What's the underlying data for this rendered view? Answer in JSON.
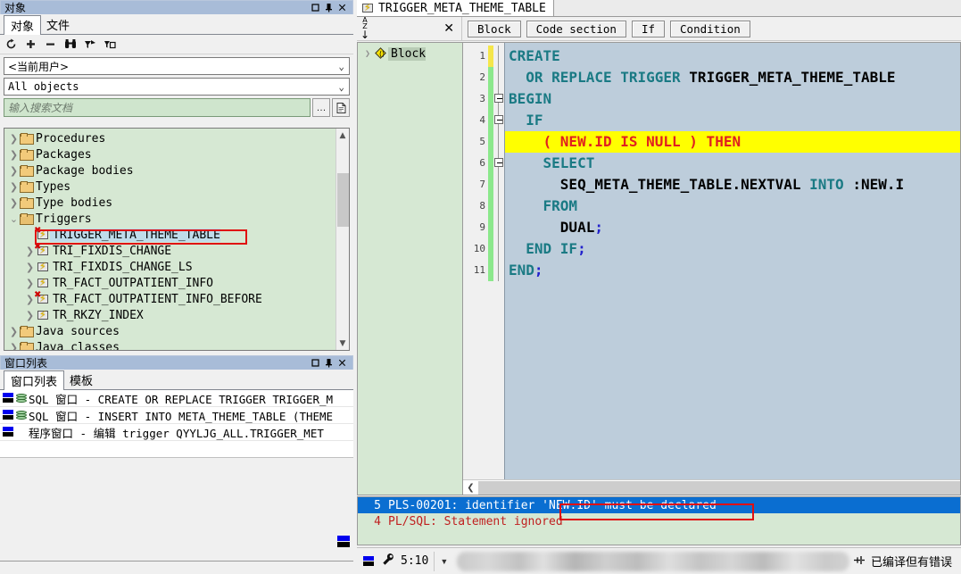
{
  "objects_panel": {
    "caption": "对象",
    "caption_buttons": [
      "maximize",
      "pin",
      "close"
    ],
    "tabs": [
      {
        "label": "对象",
        "active": true
      },
      {
        "label": "文件",
        "active": false
      }
    ],
    "toolbar_icons": [
      "refresh-icon",
      "add-icon",
      "remove-icon",
      "binoculars-icon",
      "filter-icon",
      "filter-copy-icon"
    ],
    "owner_combo": {
      "value": "<当前用户>"
    },
    "filter_combo": {
      "value": "All objects"
    },
    "search": {
      "placeholder": "输入搜索文档",
      "value": ""
    },
    "search_buttons": [
      "ellipsis-button",
      "document-button"
    ],
    "tree": [
      {
        "label": "Procedures",
        "icon": "folder-icon",
        "level": 1,
        "expander": "collapsed",
        "selected": false
      },
      {
        "label": "Packages",
        "icon": "folder-icon",
        "level": 1,
        "expander": "collapsed",
        "selected": false
      },
      {
        "label": "Package bodies",
        "icon": "folder-icon",
        "level": 1,
        "expander": "collapsed",
        "selected": false
      },
      {
        "label": "Types",
        "icon": "folder-icon",
        "level": 1,
        "expander": "collapsed",
        "selected": false
      },
      {
        "label": "Type bodies",
        "icon": "folder-icon",
        "level": 1,
        "expander": "collapsed",
        "selected": false
      },
      {
        "label": "Triggers",
        "icon": "folder-open-icon",
        "level": 1,
        "expander": "expanded",
        "selected": false
      },
      {
        "label": "TRIGGER_META_THEME_TABLE",
        "icon": "trigger-error-icon",
        "level": 2,
        "expander": "none",
        "selected": true
      },
      {
        "label": "TRI_FIXDIS_CHANGE",
        "icon": "trigger-error-icon",
        "level": 2,
        "expander": "collapsed",
        "selected": false
      },
      {
        "label": "TRI_FIXDIS_CHANGE_LS",
        "icon": "trigger-icon",
        "level": 2,
        "expander": "collapsed",
        "selected": false
      },
      {
        "label": "TR_FACT_OUTPATIENT_INFO",
        "icon": "trigger-icon",
        "level": 2,
        "expander": "collapsed",
        "selected": false
      },
      {
        "label": "TR_FACT_OUTPATIENT_INFO_BEFORE",
        "icon": "trigger-error-icon",
        "level": 2,
        "expander": "collapsed",
        "selected": false
      },
      {
        "label": "TR_RKZY_INDEX",
        "icon": "trigger-icon",
        "level": 2,
        "expander": "collapsed",
        "selected": false
      },
      {
        "label": "Java sources",
        "icon": "folder-icon",
        "level": 1,
        "expander": "collapsed",
        "selected": false
      },
      {
        "label": "Java classes",
        "icon": "folder-icon",
        "level": 1,
        "expander": "collapsed",
        "selected": false
      }
    ],
    "highlight_color": "#e01010"
  },
  "window_list_panel": {
    "caption": "窗口列表",
    "caption_buttons": [
      "maximize",
      "pin",
      "close"
    ],
    "tabs": [
      {
        "label": "窗口列表",
        "active": true
      },
      {
        "label": "模板",
        "active": false
      }
    ],
    "rows": [
      {
        "icon": "sql-window-icon",
        "has_db_icon": true,
        "text": "SQL 窗口 - CREATE OR REPLACE TRIGGER TRIGGER_M"
      },
      {
        "icon": "sql-window-icon",
        "has_db_icon": true,
        "text": "SQL 窗口 - INSERT INTO META_THEME_TABLE (THEME"
      },
      {
        "icon": "program-window-icon",
        "has_db_icon": false,
        "text": "程序窗口 - 编辑 trigger QYYLJG_ALL.TRIGGER_MET"
      }
    ]
  },
  "editor": {
    "document_tab": {
      "label": "TRIGGER_META_THEME_TABLE",
      "icon": "trigger-icon"
    },
    "toolbar": {
      "sort_icon": "sort-az-icon",
      "close_icon": "close-icon",
      "buttons": [
        "Block",
        "Code section",
        "If",
        "Condition"
      ]
    },
    "structure_tree": [
      {
        "label": "Block",
        "icon": "block-diamond-icon",
        "expander": "collapsed",
        "selected": true
      }
    ],
    "gutter_numbers": [
      "1",
      "2",
      "3",
      "4",
      "5",
      "6",
      "7",
      "8",
      "9",
      "10",
      "11"
    ],
    "change_bar": [
      "yellow",
      "green",
      "green",
      "green",
      "green",
      "green",
      "green",
      "green",
      "green",
      "green",
      "green"
    ],
    "fold_markers": [
      false,
      false,
      true,
      true,
      false,
      true,
      false,
      false,
      false,
      false,
      false
    ],
    "lines": [
      {
        "n": 1,
        "highlight": false,
        "tokens": [
          {
            "t": "CREATE",
            "c": "kw"
          }
        ]
      },
      {
        "n": 2,
        "highlight": false,
        "tokens": [
          {
            "t": "  OR REPLACE TRIGGER ",
            "c": "kw"
          },
          {
            "t": "TRIGGER_META_THEME_TABLE",
            "c": "id"
          }
        ]
      },
      {
        "n": 3,
        "highlight": false,
        "tokens": [
          {
            "t": "BEGIN",
            "c": "kw"
          }
        ]
      },
      {
        "n": 4,
        "highlight": false,
        "tokens": [
          {
            "t": "  IF",
            "c": "kw"
          }
        ]
      },
      {
        "n": 5,
        "highlight": true,
        "tokens": [
          {
            "t": "    ( NEW.ID IS NULL ) THEN",
            "c": "err"
          }
        ]
      },
      {
        "n": 6,
        "highlight": false,
        "tokens": [
          {
            "t": "    SELECT",
            "c": "kw"
          }
        ]
      },
      {
        "n": 7,
        "highlight": false,
        "tokens": [
          {
            "t": "      SEQ_META_THEME_TABLE.NEXTVAL ",
            "c": "id"
          },
          {
            "t": "INTO ",
            "c": "kw"
          },
          {
            "t": ":NEW.I",
            "c": "id"
          }
        ]
      },
      {
        "n": 8,
        "highlight": false,
        "tokens": [
          {
            "t": "    FROM",
            "c": "kw"
          }
        ]
      },
      {
        "n": 9,
        "highlight": false,
        "tokens": [
          {
            "t": "      DUAL",
            "c": "id"
          },
          {
            "t": ";",
            "c": "pn"
          }
        ]
      },
      {
        "n": 10,
        "highlight": false,
        "tokens": [
          {
            "t": "  END IF",
            "c": "kw"
          },
          {
            "t": ";",
            "c": "pn"
          }
        ]
      },
      {
        "n": 11,
        "highlight": false,
        "tokens": [
          {
            "t": "END",
            "c": "kw"
          },
          {
            "t": ";",
            "c": "pn"
          }
        ]
      }
    ]
  },
  "errors": {
    "rows": [
      {
        "line": "5",
        "text": "PLS-00201: identifier 'NEW.ID' must be declared",
        "selected": true
      },
      {
        "line": "4",
        "text": "PL/SQL: Statement ignored",
        "selected": false
      }
    ],
    "highlight_color": "#e01010"
  },
  "statusbar": {
    "icon": "program-window-icon",
    "tool_icon": "wrench-icon",
    "position": "5:10",
    "dropdown_icon": "caret-down-icon",
    "compile_icon": "compile-icon",
    "compile_status": "已编译但有错误"
  },
  "colors": {
    "caption_bar": "#a8bcd8",
    "panel_green": "#d6e8d3",
    "code_background": "#bdcddb",
    "highlight_line": "#ffff00",
    "keyword": "#1a7a84",
    "error_text": "#e02020",
    "selection_blue": "#0a6ed1"
  }
}
